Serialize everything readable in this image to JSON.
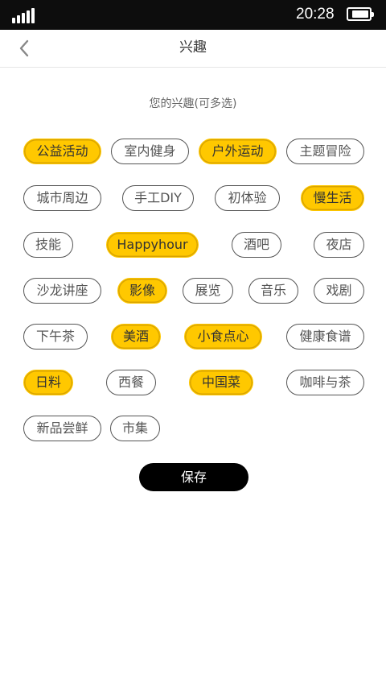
{
  "status_bar": {
    "time": "20:28",
    "signal_bars": 5,
    "battery_level": 0.85
  },
  "header": {
    "title": "兴趣",
    "back_icon": "chevron-left-icon"
  },
  "subtitle": "您的兴趣(可多选)",
  "tags": [
    {
      "label": "公益活动",
      "selected": true
    },
    {
      "label": "室内健身",
      "selected": false
    },
    {
      "label": "户外运动",
      "selected": true
    },
    {
      "label": "主题冒险",
      "selected": false
    },
    {
      "label": "城市周边",
      "selected": false
    },
    {
      "label": "手工DIY",
      "selected": false
    },
    {
      "label": "初体验",
      "selected": false
    },
    {
      "label": "慢生活",
      "selected": true
    },
    {
      "label": "技能",
      "selected": false
    },
    {
      "label": "Happyhour",
      "selected": true
    },
    {
      "label": "酒吧",
      "selected": false
    },
    {
      "label": "夜店",
      "selected": false
    },
    {
      "label": "沙龙讲座",
      "selected": false
    },
    {
      "label": "影像",
      "selected": true
    },
    {
      "label": "展览",
      "selected": false
    },
    {
      "label": "音乐",
      "selected": false
    },
    {
      "label": "戏剧",
      "selected": false
    },
    {
      "label": "下午茶",
      "selected": false
    },
    {
      "label": "美酒",
      "selected": true
    },
    {
      "label": "小食点心",
      "selected": true
    },
    {
      "label": "健康食谱",
      "selected": false
    },
    {
      "label": "日料",
      "selected": true
    },
    {
      "label": "西餐",
      "selected": false
    },
    {
      "label": "中国菜",
      "selected": true
    },
    {
      "label": "咖啡与茶",
      "selected": false
    },
    {
      "label": "新品尝鲜",
      "selected": false
    },
    {
      "label": "市集",
      "selected": false
    }
  ],
  "save_label": "保存",
  "colors": {
    "selected": "#ffc800",
    "status_bar": "#0d0d0d",
    "button": "#000000"
  }
}
